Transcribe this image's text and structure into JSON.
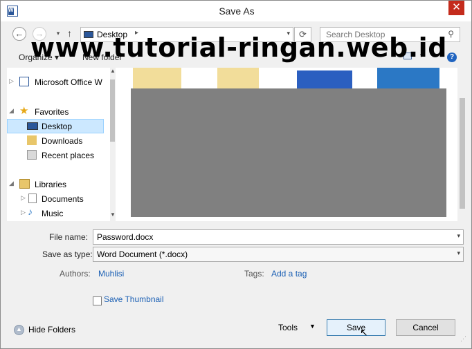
{
  "window": {
    "title": "Save As",
    "close_glyph": "✕"
  },
  "address_bar": {
    "location": "Desktop",
    "search_placeholder": "Search Desktop"
  },
  "toolbar": {
    "organize_label": "Organize ▾",
    "new_folder_label": "New folder"
  },
  "watermark": "www.tutorial-ringan.web.id",
  "nav_pane": {
    "items": [
      {
        "label": "Microsoft Office W",
        "icon": "word-document-icon"
      },
      {
        "label": "Favorites",
        "icon": "star-icon"
      },
      {
        "label": "Desktop",
        "icon": "desktop-icon"
      },
      {
        "label": "Downloads",
        "icon": "downloads-icon"
      },
      {
        "label": "Recent places",
        "icon": "recent-places-icon"
      },
      {
        "label": "Libraries",
        "icon": "libraries-icon"
      },
      {
        "label": "Documents",
        "icon": "documents-icon"
      },
      {
        "label": "Music",
        "icon": "music-icon"
      }
    ],
    "selected": "Desktop"
  },
  "form": {
    "file_name_label": "File name:",
    "file_name_value": "Password.docx",
    "save_type_label": "Save as type:",
    "save_type_value": "Word Document (*.docx)",
    "authors_label": "Authors:",
    "authors_value": "Muhlisi",
    "tags_label": "Tags:",
    "tags_value": "Add a tag",
    "thumbnail_label": "Save Thumbnail"
  },
  "footer": {
    "hide_folders_label": "Hide Folders",
    "tools_label": "Tools",
    "save_label": "Save",
    "cancel_label": "Cancel"
  },
  "colors": {
    "accent": "#2b579a",
    "close": "#c42b1c",
    "link": "#1a5fb4",
    "selection": "#cce8ff"
  }
}
